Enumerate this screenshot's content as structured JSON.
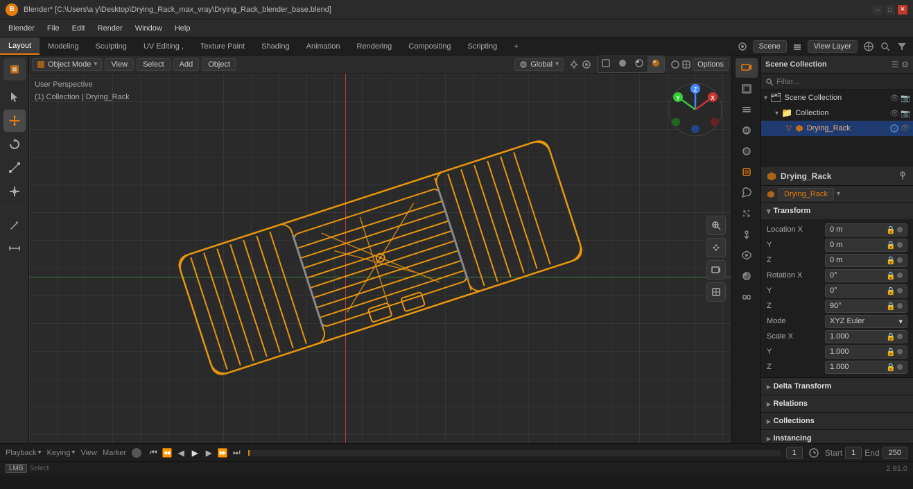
{
  "titlebar": {
    "title": "Blender* [C:\\Users\\a y\\Desktop\\Drying_Rack_max_vray\\Drying_Rack_blender_base.blend]",
    "logo": "B"
  },
  "menubar": {
    "items": [
      "Blender",
      "File",
      "Edit",
      "Render",
      "Window",
      "Help"
    ]
  },
  "workspace_tabs": {
    "items": [
      "Layout",
      "Modeling",
      "Sculpting",
      "UV Editing ,",
      "Texture Paint",
      "Shading",
      "Animation",
      "Rendering",
      "Compositing",
      "Scripting"
    ],
    "active": "Layout",
    "plus_label": "+",
    "scene_label": "Scene",
    "view_layer_label": "View Layer"
  },
  "viewport_header": {
    "mode_label": "Object Mode",
    "view_label": "View",
    "select_label": "Select",
    "add_label": "Add",
    "object_label": "Object",
    "transform_label": "Global",
    "snap_label": "Snap",
    "options_label": "Options"
  },
  "viewport": {
    "info_line1": "User Perspective",
    "info_line2": "(1) Collection | Drying_Rack"
  },
  "left_tools": {
    "icons": [
      "cursor",
      "move",
      "rotate",
      "scale",
      "transform",
      "annotate",
      "ruler"
    ]
  },
  "outliner": {
    "title": "Scene Collection",
    "search_placeholder": "Filter...",
    "items": [
      {
        "label": "Scene Collection",
        "icon": "📁",
        "indent": 0,
        "eye": true,
        "camera": true
      },
      {
        "label": "Collection",
        "icon": "📁",
        "indent": 1,
        "eye": true,
        "camera": true
      },
      {
        "label": "Drying_Rack",
        "icon": "▽",
        "indent": 2,
        "eye": true,
        "camera": true,
        "active": true
      }
    ]
  },
  "properties": {
    "object_name": "Drying_Rack",
    "data_name": "Drying_Rack",
    "pin_icon": "📌",
    "transform": {
      "title": "Transform",
      "location_x": "0 m",
      "location_y": "0 m",
      "location_z": "0 m",
      "rotation_x": "0°",
      "rotation_y": "0°",
      "rotation_z": "90°",
      "mode_label": "Mode",
      "mode_value": "XYZ Euler",
      "scale_x": "1.000",
      "scale_y": "1.000",
      "scale_z": "1.000"
    },
    "sections": [
      {
        "label": "Delta Transform",
        "collapsed": true
      },
      {
        "label": "Relations",
        "collapsed": true
      },
      {
        "label": "Collections",
        "collapsed": true
      },
      {
        "label": "Instancing",
        "collapsed": true
      }
    ]
  },
  "timeline": {
    "playback_label": "Playback",
    "keying_label": "Keying",
    "view_label": "View",
    "marker_label": "Marker",
    "frame_current": "1",
    "frame_start_label": "Start",
    "frame_start": "1",
    "frame_end_label": "End",
    "frame_end": "250"
  },
  "statusbar": {
    "select_label": "Select",
    "version": "2.91.0"
  },
  "colors": {
    "accent": "#e87d0d",
    "active_object": "#e8960d",
    "bg_dark": "#1a1a1a",
    "bg_medium": "#2b2b2b",
    "bg_panel": "#1e1e1e",
    "selected_outliner": "#1f3a6e"
  }
}
